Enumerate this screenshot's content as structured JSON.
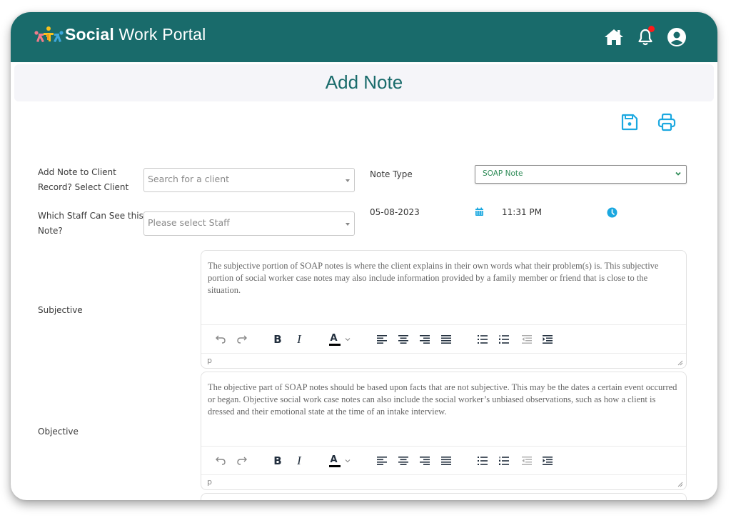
{
  "header": {
    "brand_bold": "Social",
    "brand_light": " Work Portal",
    "icons": [
      "home-icon",
      "bell-icon",
      "user-circle-icon"
    ],
    "notification_dot_color": "#ff1a1a",
    "bar_color": "#196b6b"
  },
  "page": {
    "title": "Add Note",
    "actions": [
      "save-icon",
      "print-icon"
    ],
    "accent_color": "#1ba8e0"
  },
  "form": {
    "client": {
      "label_line1": "Add Note to Client",
      "label_line2": "Record? Select Client",
      "placeholder": "Search for a client"
    },
    "staff": {
      "label_line1": "Which Staff Can See this",
      "label_line2": "Note?",
      "placeholder": "Please select Staff"
    },
    "note_type": {
      "label": "Note Type",
      "selected": "SOAP Note"
    },
    "date": "05-08-2023",
    "time": "11:31 PM"
  },
  "sections": [
    {
      "label": "Subjective",
      "content": "The subjective portion of SOAP notes is where the client explains in their own words what their problem(s) is. This subjective portion of social worker case notes may also include information provided by a family member or friend that is close to the situation.",
      "status_path": "p"
    },
    {
      "label": "Objective",
      "content": "The objective part of SOAP notes should be based upon facts that are not subjective. This may be the dates a certain event occurred or began. Objective social work case notes can also include the social worker’s unbiased observations, such as how a client is dressed and their emotional state at the time of an intake interview.",
      "status_path": "p"
    }
  ],
  "toolbar": {
    "buttons": [
      "undo",
      "redo",
      "bold",
      "italic",
      "text-color",
      "align-left",
      "align-center",
      "align-right",
      "align-justify",
      "bullet-list",
      "numbered-list",
      "outdent",
      "indent"
    ],
    "bold_glyph": "B",
    "italic_glyph": "I",
    "color_glyph": "A"
  }
}
